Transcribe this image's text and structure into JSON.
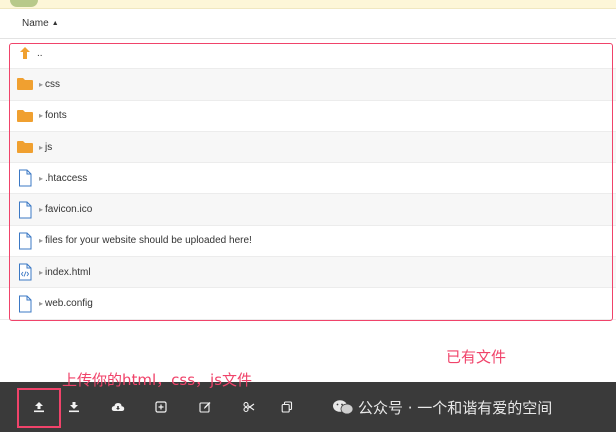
{
  "header": {
    "name_label": "Name"
  },
  "files": [
    {
      "name": "..",
      "type": "parent"
    },
    {
      "name": "css",
      "type": "folder"
    },
    {
      "name": "fonts",
      "type": "folder"
    },
    {
      "name": "js",
      "type": "folder"
    },
    {
      "name": ".htaccess",
      "type": "file"
    },
    {
      "name": "favicon.ico",
      "type": "file"
    },
    {
      "name": "files for your website should be uploaded here!",
      "type": "file"
    },
    {
      "name": "index.html",
      "type": "html"
    },
    {
      "name": "web.config",
      "type": "file"
    }
  ],
  "annotations": {
    "existing_files": "已有文件",
    "upload_hint": "上传你的html，css，js文件"
  },
  "toolbar": {
    "buttons": [
      {
        "icon": "upload-icon",
        "glyph": "⇪"
      },
      {
        "icon": "download-icon",
        "glyph": "⤓"
      },
      {
        "icon": "cloud-download-icon",
        "glyph": "☁"
      },
      {
        "icon": "add-icon",
        "glyph": "⊞"
      },
      {
        "icon": "edit-icon",
        "glyph": "✎"
      },
      {
        "icon": "cut-icon",
        "glyph": "✂"
      },
      {
        "icon": "copy-icon",
        "glyph": "⧉"
      }
    ]
  },
  "watermark": {
    "text": "公众号 · 一个和谐有爱的空间"
  },
  "colors": {
    "annotation_red": "#f0436a",
    "folder_orange": "#f0a030",
    "toolbar_bg": "#3a3a3a"
  }
}
